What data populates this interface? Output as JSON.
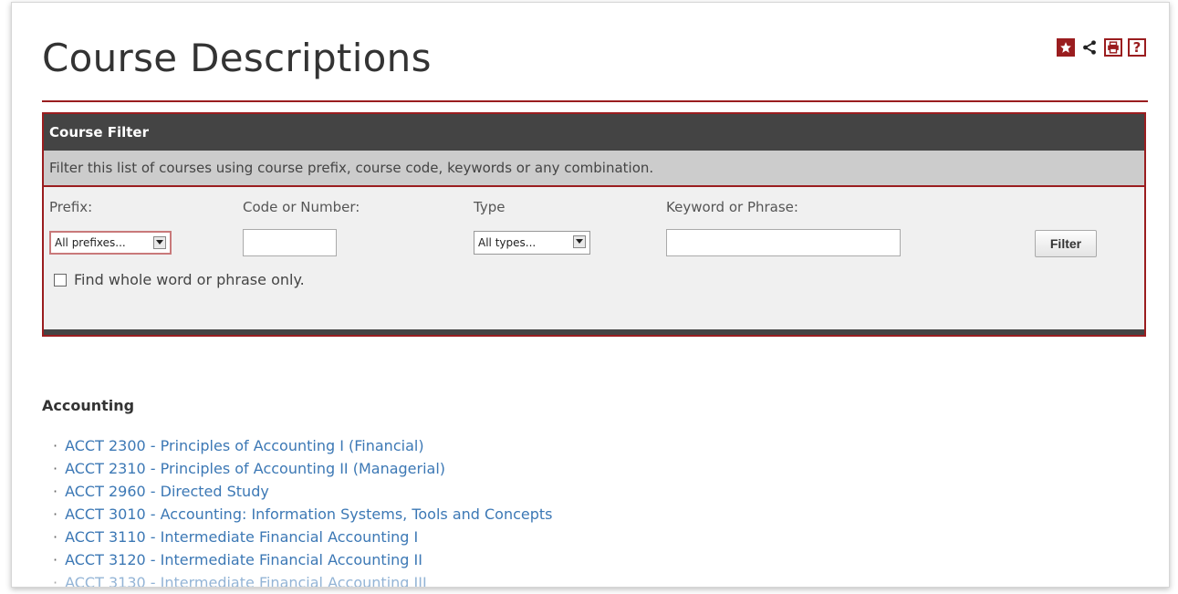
{
  "page": {
    "title": "Course Descriptions"
  },
  "toolbar": {
    "favorite_icon": "star-icon",
    "share_icon": "share-icon",
    "print_icon": "print-icon",
    "help_icon": "help-icon",
    "help_glyph": "?",
    "accent_color": "#9a1d1f"
  },
  "filter": {
    "heading": "Course Filter",
    "description": "Filter this list of courses using course prefix, course code, keywords or any combination.",
    "prefix_label": "Prefix:",
    "prefix_value": "All prefixes...",
    "code_label": "Code or Number:",
    "code_value": "",
    "type_label": "Type",
    "type_value": "All types...",
    "keyword_label": "Keyword or Phrase:",
    "keyword_value": "",
    "whole_word_label": "Find whole word or phrase only.",
    "whole_word_checked": false,
    "button_label": "Filter"
  },
  "section": {
    "heading": "Accounting",
    "link_color": "#3c78b5",
    "courses": [
      "ACCT 2300 - Principles of Accounting I (Financial)",
      "ACCT 2310 - Principles of Accounting II (Managerial)",
      "ACCT 2960 - Directed Study",
      "ACCT 3010 - Accounting: Information Systems, Tools and Concepts",
      "ACCT 3110 - Intermediate Financial Accounting I",
      "ACCT 3120 - Intermediate Financial Accounting II",
      "ACCT 3130 - Intermediate Financial Accounting III"
    ]
  }
}
